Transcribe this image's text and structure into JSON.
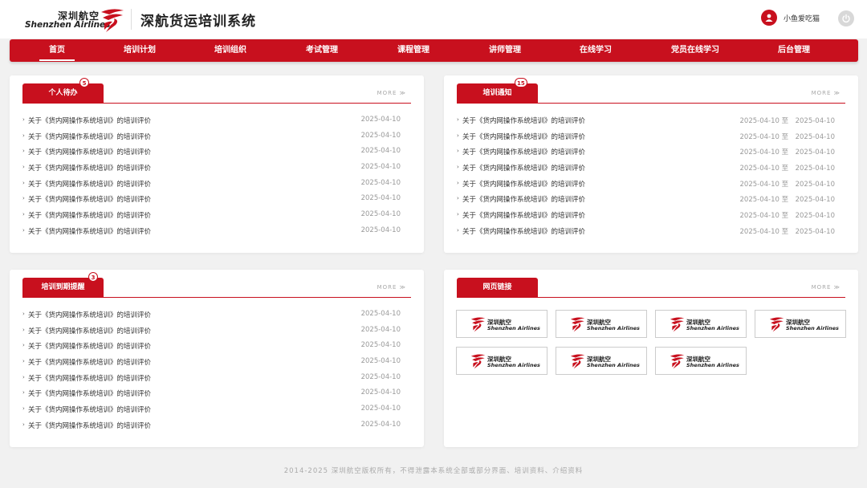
{
  "header": {
    "logo_cn": "深圳航空",
    "logo_en": "Shenzhen Airlines",
    "system_title": "深航货运培训系统",
    "username": "小鱼爱吃猫",
    "brand_color": "#c8101e"
  },
  "nav": {
    "items": [
      {
        "label": "首页",
        "active": true
      },
      {
        "label": "培训计划"
      },
      {
        "label": "培训组织"
      },
      {
        "label": "考试管理"
      },
      {
        "label": "课程管理"
      },
      {
        "label": "讲师管理"
      },
      {
        "label": "在线学习"
      },
      {
        "label": "党员在线学习"
      },
      {
        "label": "后台管理"
      }
    ]
  },
  "panels": {
    "todo": {
      "title": "个人待办",
      "badge": "5",
      "more": "MORE",
      "rows": [
        {
          "title": "关于《货内网操作系统培训》的培训评价",
          "date": "2025-04-10"
        },
        {
          "title": "关于《货内网操作系统培训》的培训评价",
          "date": "2025-04-10"
        },
        {
          "title": "关于《货内网操作系统培训》的培训评价",
          "date": "2025-04-10"
        },
        {
          "title": "关于《货内网操作系统培训》的培训评价",
          "date": "2025-04-10"
        },
        {
          "title": "关于《货内网操作系统培训》的培训评价",
          "date": "2025-04-10"
        },
        {
          "title": "关于《货内网操作系统培训》的培训评价",
          "date": "2025-04-10"
        },
        {
          "title": "关于《货内网操作系统培训》的培训评价",
          "date": "2025-04-10"
        },
        {
          "title": "关于《货内网操作系统培训》的培训评价",
          "date": "2025-04-10"
        }
      ]
    },
    "notice": {
      "title": "培训通知",
      "badge": "15",
      "more": "MORE",
      "rows": [
        {
          "title": "关于《货内网操作系统培训》的培训评价",
          "range": "2025-04-10 至　2025-04-10"
        },
        {
          "title": "关于《货内网操作系统培训》的培训评价",
          "range": "2025-04-10 至　2025-04-10"
        },
        {
          "title": "关于《货内网操作系统培训》的培训评价",
          "range": "2025-04-10 至　2025-04-10"
        },
        {
          "title": "关于《货内网操作系统培训》的培训评价",
          "range": "2025-04-10 至　2025-04-10"
        },
        {
          "title": "关于《货内网操作系统培训》的培训评价",
          "range": "2025-04-10 至　2025-04-10"
        },
        {
          "title": "关于《货内网操作系统培训》的培训评价",
          "range": "2025-04-10 至　2025-04-10"
        },
        {
          "title": "关于《货内网操作系统培训》的培训评价",
          "range": "2025-04-10 至　2025-04-10"
        },
        {
          "title": "关于《货内网操作系统培训》的培训评价",
          "range": "2025-04-10 至　2025-04-10"
        }
      ]
    },
    "expiry": {
      "title": "培训到期提醒",
      "badge": "3",
      "more": "MORE",
      "rows": [
        {
          "title": "关于《货内网操作系统培训》的培训评价",
          "date": "2025-04-10"
        },
        {
          "title": "关于《货内网操作系统培训》的培训评价",
          "date": "2025-04-10"
        },
        {
          "title": "关于《货内网操作系统培训》的培训评价",
          "date": "2025-04-10"
        },
        {
          "title": "关于《货内网操作系统培训》的培训评价",
          "date": "2025-04-10"
        },
        {
          "title": "关于《货内网操作系统培训》的培训评价",
          "date": "2025-04-10"
        },
        {
          "title": "关于《货内网操作系统培训》的培训评价",
          "date": "2025-04-10"
        },
        {
          "title": "关于《货内网操作系统培训》的培训评价",
          "date": "2025-04-10"
        },
        {
          "title": "关于《货内网操作系统培训》的培训评价",
          "date": "2025-04-10"
        }
      ]
    },
    "links": {
      "title": "网页链接",
      "more": "MORE",
      "cards": [
        {
          "cn": "深圳航空",
          "en": "Shenzhen Airlines"
        },
        {
          "cn": "深圳航空",
          "en": "Shenzhen Airlines"
        },
        {
          "cn": "深圳航空",
          "en": "Shenzhen Airlines"
        },
        {
          "cn": "深圳航空",
          "en": "Shenzhen Airlines"
        },
        {
          "cn": "深圳航空",
          "en": "Shenzhen Airlines"
        },
        {
          "cn": "深圳航空",
          "en": "Shenzhen Airlines"
        },
        {
          "cn": "深圳航空",
          "en": "Shenzhen Airlines"
        }
      ]
    }
  },
  "footer": {
    "text": "2014-2025 深圳航空版权所有，不得泄露本系统全部或部分界面、培训资料、介绍资料"
  }
}
